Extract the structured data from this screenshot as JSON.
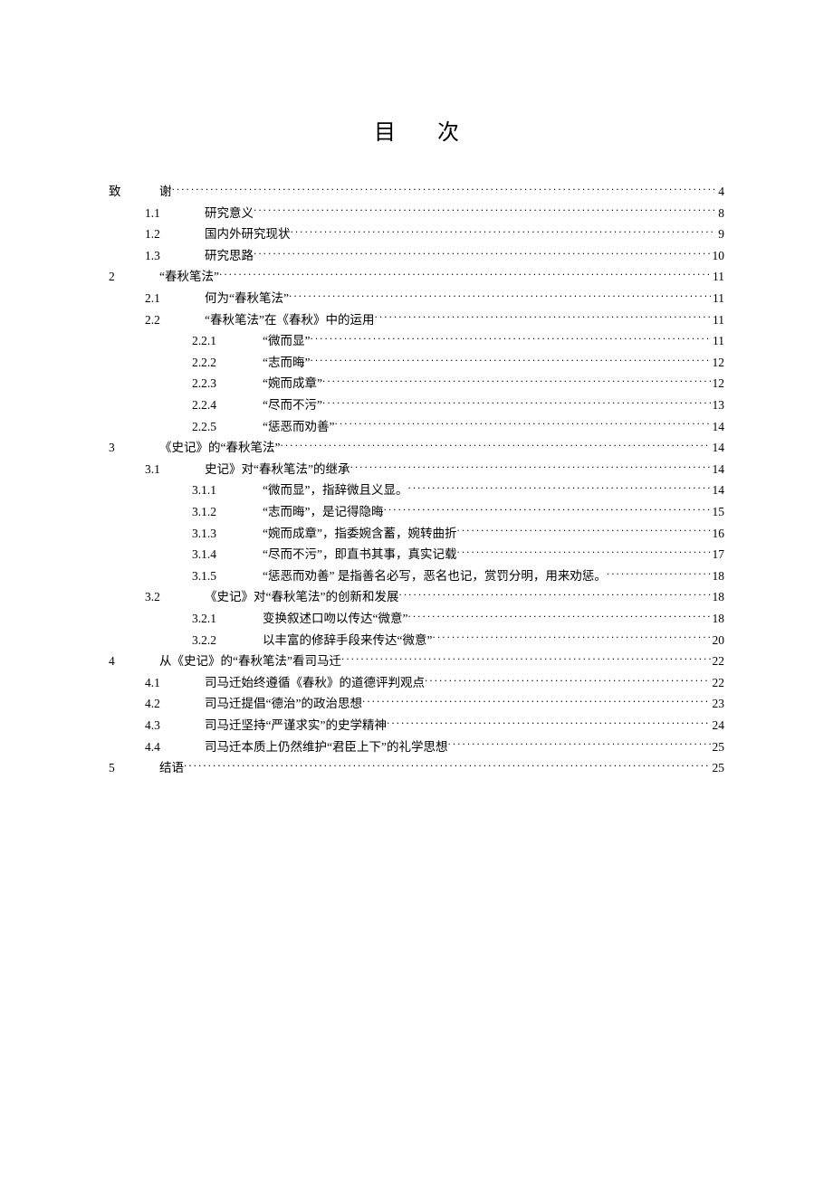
{
  "title": "目  次",
  "toc": [
    {
      "level": 0,
      "num": "致",
      "text": "谢",
      "page": "4"
    },
    {
      "level": 1,
      "num": "1.1",
      "text": "研究意义",
      "page": "8"
    },
    {
      "level": 1,
      "num": "1.2",
      "text": "国内外研究现状",
      "page": "9"
    },
    {
      "level": 1,
      "num": "1.3",
      "text": "研究思路",
      "page": "10"
    },
    {
      "level": 0,
      "num": "2",
      "text": "“春秋笔法”",
      "page": "11"
    },
    {
      "level": 1,
      "num": "2.1",
      "text": "何为“春秋笔法”",
      "page": "11"
    },
    {
      "level": 1,
      "num": "2.2",
      "text": "“春秋笔法”在《春秋》中的运用",
      "page": "11"
    },
    {
      "level": 2,
      "num": "2.2.1",
      "text": "“微而显”",
      "page": "11"
    },
    {
      "level": 2,
      "num": "2.2.2",
      "text": "“志而晦”",
      "page": "12"
    },
    {
      "level": 2,
      "num": "2.2.3",
      "text": "“婉而成章”",
      "page": "12"
    },
    {
      "level": 2,
      "num": "2.2.4",
      "text": "“尽而不污”",
      "page": "13"
    },
    {
      "level": 2,
      "num": "2.2.5",
      "text": "“惩恶而劝善”",
      "page": "14"
    },
    {
      "level": 0,
      "num": "3",
      "text": "《史记》的“春秋笔法”",
      "page": "14"
    },
    {
      "level": 1,
      "num": "3.1",
      "text": "史记》对“春秋笔法”的继承",
      "page": "14"
    },
    {
      "level": 2,
      "num": "3.1.1",
      "text": "“微而显”，指辞微且义显。",
      "page": "14"
    },
    {
      "level": 2,
      "num": "3.1.2",
      "text": "“志而晦”，是记得隐晦",
      "page": "15"
    },
    {
      "level": 2,
      "num": "3.1.3",
      "text": "“婉而成章”，指委婉含蓄，婉转曲折",
      "page": "16"
    },
    {
      "level": 2,
      "num": "3.1.4",
      "text": "“尽而不污”，即直书其事，真实记载",
      "page": "17"
    },
    {
      "level": 2,
      "num": "3.1.5",
      "text": "“惩恶而劝善” 是指善名必写，恶名也记，赏罚分明，用来劝惩。",
      "page": "18"
    },
    {
      "level": 1,
      "num": "3.2",
      "text": "《史记》对“春秋笔法”的创新和发展",
      "page": "18"
    },
    {
      "level": 2,
      "num": "3.2.1",
      "text": "变换叙述口吻以传达“微意”",
      "page": "18"
    },
    {
      "level": 2,
      "num": "3.2.2",
      "text": "以丰富的修辞手段来传达“微意”",
      "page": "20"
    },
    {
      "level": 0,
      "num": "4",
      "text": "从《史记》的“春秋笔法”看司马迁",
      "page": "22"
    },
    {
      "level": 1,
      "num": "4.1",
      "text": "司马迁始终遵循《春秋》的道德评判观点",
      "page": "22"
    },
    {
      "level": 1,
      "num": "4.2",
      "text": "司马迁提倡“德治”的政治思想",
      "page": "23"
    },
    {
      "level": 1,
      "num": "4.3",
      "text": "司马迁坚持“严谨求实”的史学精神",
      "page": "24"
    },
    {
      "level": 1,
      "num": "4.4",
      "text": "司马迁本质上仍然维护“君臣上下”的礼学思想",
      "page": "25"
    },
    {
      "level": 0,
      "num": "5",
      "text": "结语",
      "page": "25"
    }
  ]
}
